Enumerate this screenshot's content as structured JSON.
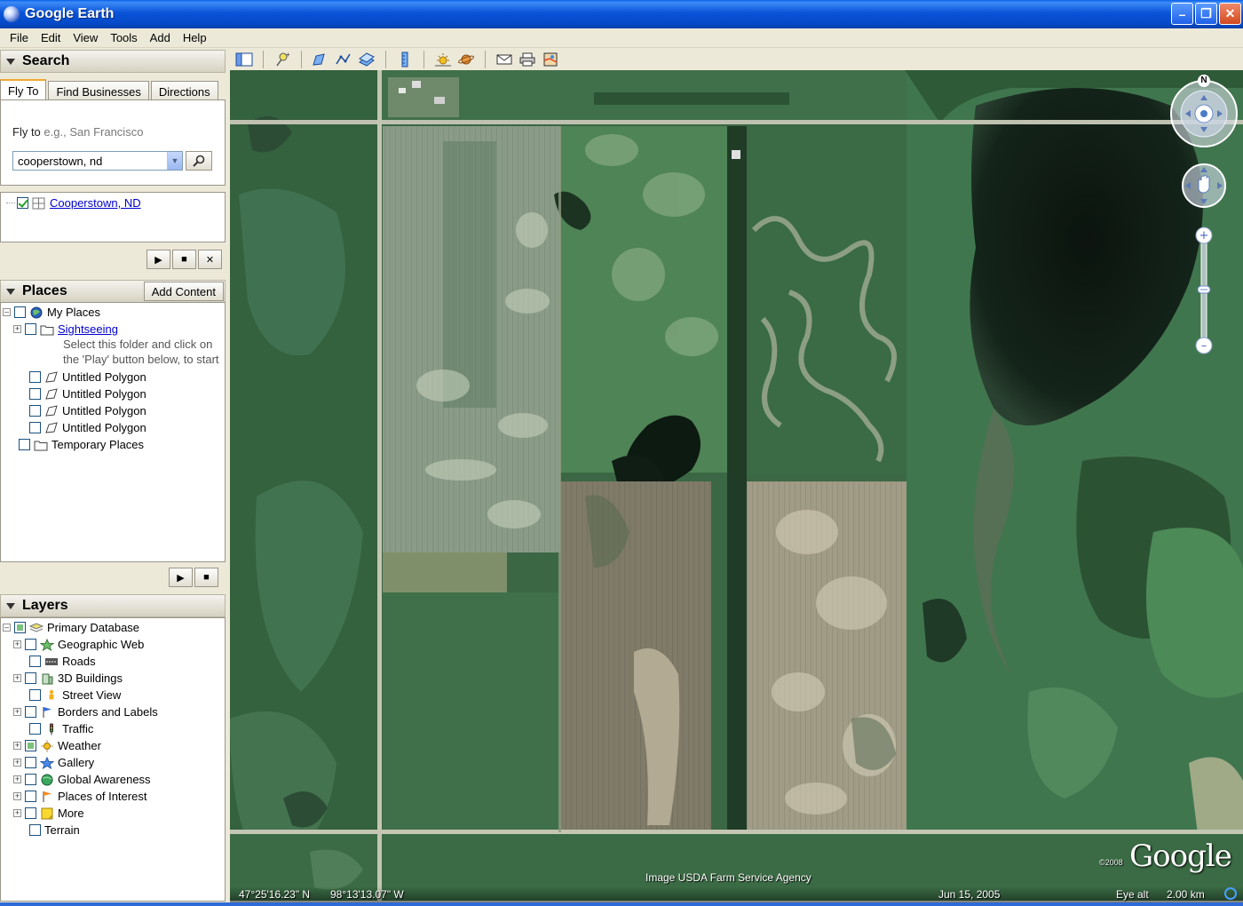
{
  "window": {
    "title": "Google Earth"
  },
  "menu": [
    "File",
    "Edit",
    "View",
    "Tools",
    "Add",
    "Help"
  ],
  "search": {
    "header": "Search",
    "tabs": [
      "Fly To",
      "Find Businesses",
      "Directions"
    ],
    "flyto_label": "Fly to",
    "flyto_placeholder": "e.g., San Francisco",
    "query": "cooperstown, nd",
    "result": "Cooperstown, ND"
  },
  "places": {
    "header": "Places",
    "add_content": "Add Content",
    "my_places": "My Places",
    "sightseeing": "Sightseeing",
    "sightseeing_desc_1": "Select this folder and click on",
    "sightseeing_desc_2": "the 'Play' button below, to start",
    "polygons": [
      "Untitled Polygon",
      "Untitled Polygon",
      "Untitled Polygon",
      "Untitled Polygon"
    ],
    "temporary": "Temporary Places"
  },
  "layers": {
    "header": "Layers",
    "primary": "Primary Database",
    "items": [
      "Geographic Web",
      "Roads",
      "3D Buildings",
      "Street View",
      "Borders and Labels",
      "Traffic",
      "Weather",
      "Gallery",
      "Global Awareness",
      "Places of Interest",
      "More"
    ],
    "terrain": "Terrain"
  },
  "status": {
    "lat": "47°25'16.23\" N",
    "lon": "98°13'13.07\" W",
    "date": "Jun 15, 2005",
    "eye_alt_label": "Eye alt",
    "eye_alt_value": "2.00 km",
    "credit": "Image USDA Farm Service Agency",
    "copyright": "©2008",
    "logo": "Google"
  },
  "nav": {
    "north": "N"
  },
  "icons": {
    "accent_green": "#21a121",
    "link_color": "#0000cc"
  }
}
